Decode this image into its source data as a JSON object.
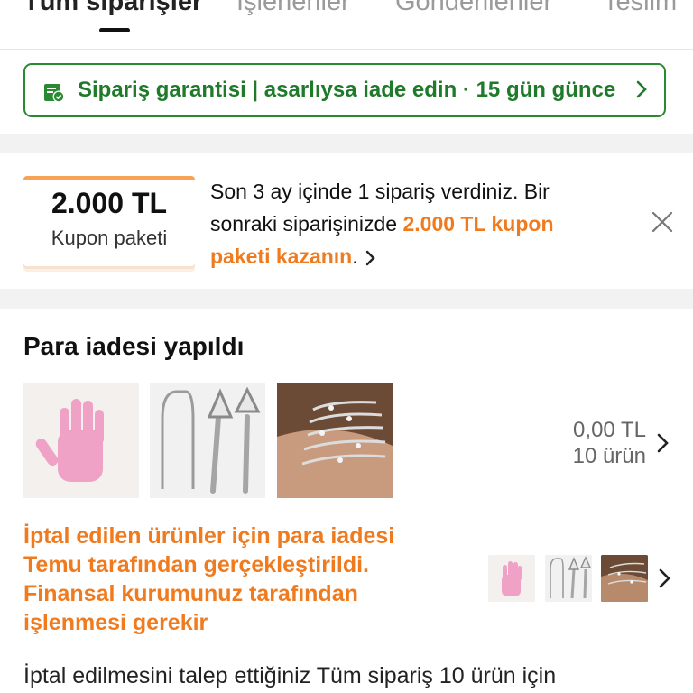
{
  "tabs": [
    {
      "label": "Tüm siparişler",
      "active": true
    },
    {
      "label": "İşlenenler",
      "active": false
    },
    {
      "label": "Gönderilenler",
      "active": false
    },
    {
      "label": "Teslim",
      "active": false
    }
  ],
  "guarantee": {
    "text": "Sipariş garantisi  |  asarlıysa iade edin  ·  15 gün günce",
    "icon": "shield-check-icon",
    "color": "#1f7a2a"
  },
  "coupon": {
    "amount": "2.000 TL",
    "label": "Kupon paketi",
    "accent": "#f07b1f"
  },
  "promo": {
    "text_prefix": "Son 3 ay içinde 1 sipariş verdiniz. Bir sonraki siparişinizde ",
    "text_highlight": "2.000 TL kupon paketi kazanın",
    "text_suffix": "."
  },
  "order": {
    "status_title": "Para iadesi yapıldı",
    "total": "0,00 TL",
    "item_count": "10 ürün",
    "thumbnails": [
      "pink-exfoliating-glove",
      "tongue-scraper-set",
      "bracelet-set"
    ]
  },
  "refund_note": "İptal edilen ürünler için para iadesi Temu tarafından gerçekleştirildi. Finansal kurumunuz tarafından işlenmesi gerekir",
  "bottom_text": "İptal edilmesini talep ettiğiniz Tüm sipariş 10 ürün için"
}
